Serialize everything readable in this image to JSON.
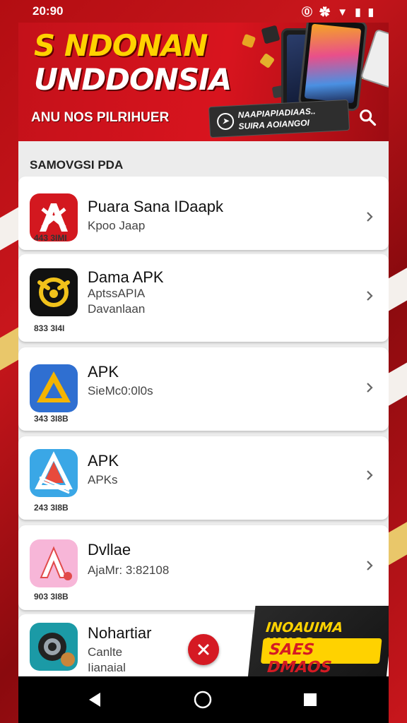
{
  "status_bar": {
    "time": "20:90",
    "icons_text": "⓪ ✿ ▼ ▮ ▮"
  },
  "banner": {
    "title_line1": "S NDONAN",
    "title_line2": "UNDDONSIA",
    "subtitle": "ANU NOS PILRIHUER",
    "promo_line1": "NAAPIAPIADIAAS..",
    "promo_line2": "SUIRA AOIANGOI"
  },
  "section_label": "SAMOVGSI PDA",
  "apps": [
    {
      "name": "Puara Sana IDaapk",
      "line1": "Kpoo Jaap",
      "line2": "",
      "size": "443 3IMI",
      "icon": "red-a-icon"
    },
    {
      "name": "Dama APK",
      "line1": "AptssAPIA",
      "line2": "Davanlaan",
      "size": "833 3I4I",
      "icon": "yellow-bull-icon"
    },
    {
      "name": "APK",
      "line1": "SieMc0:0l0s",
      "line2": "",
      "size": "343 3I8B",
      "icon": "triangle-drive-icon"
    },
    {
      "name": "APK",
      "line1": "APKs",
      "line2": "",
      "size": "243 3I8B",
      "icon": "blue-a-icon"
    },
    {
      "name": "Dvllae",
      "line1": "AjaMr: 3:82108",
      "line2": "",
      "size": "903 3I8B",
      "icon": "pink-a-icon"
    },
    {
      "name": "Nohartiar",
      "line1": "Canlte",
      "line2": "Iianaial",
      "size": "",
      "icon": "camera-gear-icon"
    }
  ],
  "ad": {
    "line1": "INOAUIMA NNIOS",
    "line2": "SAES DMAOS"
  },
  "colors": {
    "brand_red": "#d51a23",
    "gold": "#ffd200",
    "card_bg": "#ffffff"
  }
}
